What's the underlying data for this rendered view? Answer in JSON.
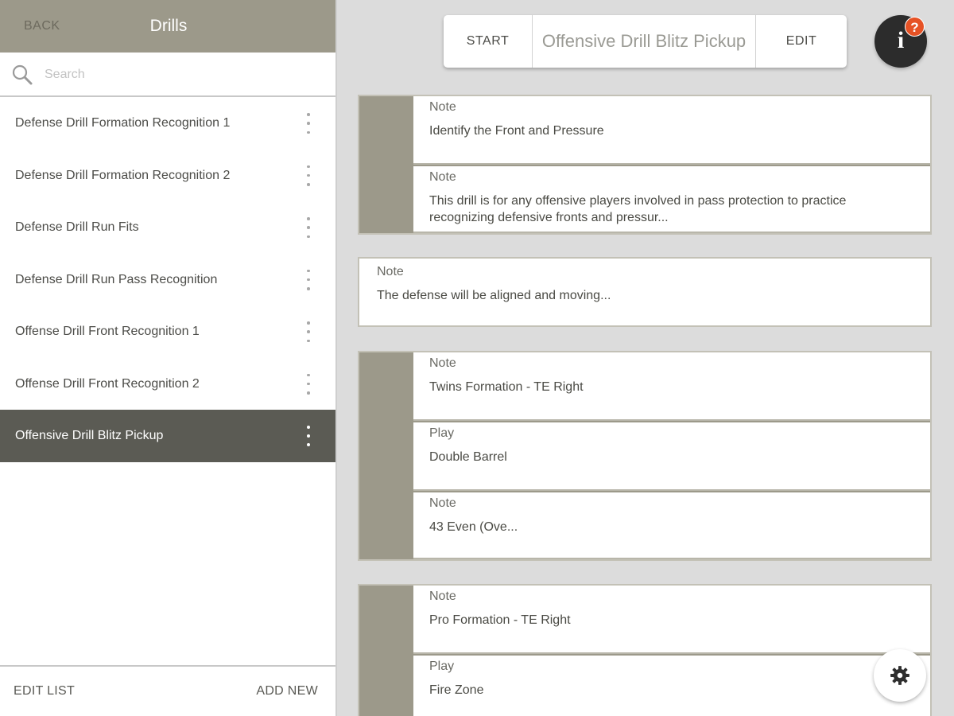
{
  "sidebar": {
    "back_label": "BACK",
    "title": "Drills",
    "search_placeholder": "Search",
    "items": [
      {
        "label": "Defense Drill Formation Recognition 1"
      },
      {
        "label": "Defense Drill Formation Recognition 2"
      },
      {
        "label": "Defense Drill Run Fits"
      },
      {
        "label": "Defense Drill Run Pass Recognition"
      },
      {
        "label": "Offense Drill Front Recognition 1"
      },
      {
        "label": "Offense Drill Front Recognition 2"
      },
      {
        "label": "Offensive Drill Blitz Pickup",
        "selected": true
      }
    ],
    "footer": {
      "edit_list": "EDIT LIST",
      "add_new": "ADD NEW"
    }
  },
  "toolbar": {
    "start_label": "START",
    "title": "Offensive Drill Blitz Pickup",
    "edit_label": "EDIT"
  },
  "info": {
    "glyph": "i",
    "badge": "?"
  },
  "groups": [
    {
      "cards": [
        {
          "label": "Note",
          "text": "Identify the Front and Pressure"
        },
        {
          "label": "Note",
          "text": "This drill is for any offensive players involved in pass protection to practice recognizing defensive fronts and pressur..."
        }
      ]
    },
    {
      "cards": [
        {
          "label": "Note",
          "text": "Twins Formation - TE Right"
        },
        {
          "label": "Play",
          "text": "Double Barrel"
        },
        {
          "label": "Note",
          "text": "43 Even (Ove..."
        }
      ]
    },
    {
      "cards": [
        {
          "label": "Note",
          "text": "Pro Formation - TE Right"
        },
        {
          "label": "Play",
          "text": "Fire Zone"
        }
      ]
    }
  ],
  "single_card": {
    "label": "Note",
    "text": "The defense will be aligned and moving..."
  },
  "colors": {
    "accent": "#9c998a",
    "selected": "#5b5b54",
    "badge": "#e65225"
  }
}
